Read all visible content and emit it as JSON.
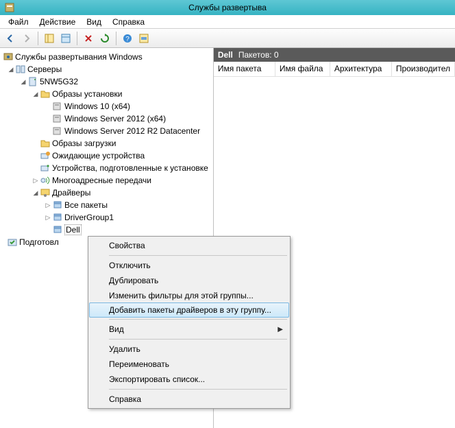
{
  "window": {
    "title": "Службы развертыва"
  },
  "menubar": {
    "file": "Файл",
    "action": "Действие",
    "view": "Вид",
    "help": "Справка"
  },
  "tree": {
    "root": "Службы развертывания Windows",
    "servers": "Серверы",
    "server_name": "5NW5G32",
    "install_images": "Образы установки",
    "img_win10": "Windows 10 (x64)",
    "img_ws2012": "Windows Server 2012 (x64)",
    "img_ws2012r2": "Windows Server 2012 R2 Datacenter",
    "boot_images": "Образы загрузки",
    "pending_devices": "Ожидающие устройства",
    "prepared_devices": "Устройства, подготовленные к установке",
    "multicast": "Многоадресные передачи",
    "drivers": "Драйверы",
    "all_packages": "Все пакеты",
    "drivergroup1": "DriverGroup1",
    "dell": "Dell",
    "prepared": "Подготовл"
  },
  "status": {
    "label_bold": "Dell",
    "label_text": "Пакетов: 0"
  },
  "columns": {
    "c1": "Имя пакета",
    "c2": "Имя файла",
    "c3": "Архитектура",
    "c4": "Производител"
  },
  "context_menu": {
    "properties": "Свойства",
    "disable": "Отключить",
    "duplicate": "Дублировать",
    "modify_filters": "Изменить фильтры для этой группы...",
    "add_packages": "Добавить пакеты драйверов в эту группу...",
    "view": "Вид",
    "delete": "Удалить",
    "rename": "Переименовать",
    "export_list": "Экспортировать список...",
    "help": "Справка"
  }
}
